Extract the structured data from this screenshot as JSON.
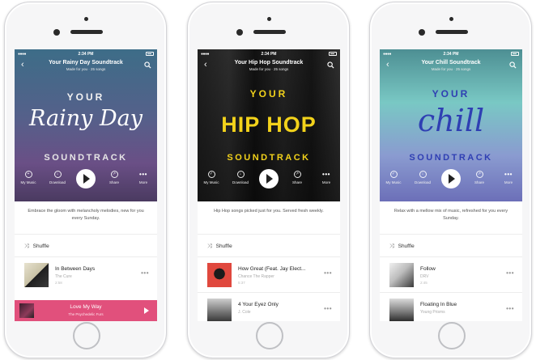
{
  "phones": [
    {
      "time": "2:34 PM",
      "title": "Your Rainy Day Soundtrack",
      "subtitle": "Made for you · 25 songs",
      "art_top": "YOUR",
      "art_main": "Rainy Day",
      "art_bottom": "SOUNDTRACK",
      "controls": [
        "My Music",
        "Download",
        "Share",
        "More"
      ],
      "description": "Embrace the gloom with melancholy melodies, new for you every Sunday.",
      "shuffle_label": "Shuffle",
      "tracks": [
        {
          "title": "In Between Days",
          "artist": "The Cure",
          "time": "2:58"
        }
      ],
      "now_playing": {
        "title": "Love My Way",
        "artist": "The Psychedelic Furs"
      },
      "colors": {
        "hero_top": "#3f6f8a",
        "hero_bottom": "#5a3c6b",
        "accent": "#e1507c"
      }
    },
    {
      "time": "2:34 PM",
      "title": "Your Hip Hop Soundtrack",
      "subtitle": "Made for you · 25 songs",
      "art_top": "YOUR",
      "art_main": "HIP HOP",
      "art_bottom": "SOUNDTRACK",
      "controls": [
        "My Music",
        "Download",
        "Share",
        "More"
      ],
      "description": "Hip Hop songs picked just for you. Served fresh weekly.",
      "shuffle_label": "Shuffle",
      "tracks": [
        {
          "title": "How Great (Feat. Jay Elect...",
          "artist": "Chance The Rapper",
          "time": "5:37"
        },
        {
          "title": "4 Your Eyez Only",
          "artist": "J. Cole",
          "time": ""
        }
      ],
      "colors": {
        "hero_top": "#1c1c1c",
        "hero_bottom": "#0e0e0e",
        "accent": "#f2d21b"
      }
    },
    {
      "time": "2:34 PM",
      "title": "Your Chill Soundtrack",
      "subtitle": "Made for you · 25 songs",
      "art_top": "YOUR",
      "art_main": "chill",
      "art_bottom": "SOUNDTRACK",
      "controls": [
        "My Music",
        "Download",
        "Share",
        "More"
      ],
      "description": "Relax with a mellow mix of music, refreshed for you every Sunday.",
      "shuffle_label": "Shuffle",
      "tracks": [
        {
          "title": "Follow",
          "artist": "DRV",
          "time": "2:45"
        },
        {
          "title": "Floating In Blue",
          "artist": "Young Prisms",
          "time": ""
        }
      ],
      "colors": {
        "hero_top": "#6fc4c6",
        "hero_bottom": "#6b6fb8",
        "accent": "#2f3fb3"
      }
    }
  ]
}
